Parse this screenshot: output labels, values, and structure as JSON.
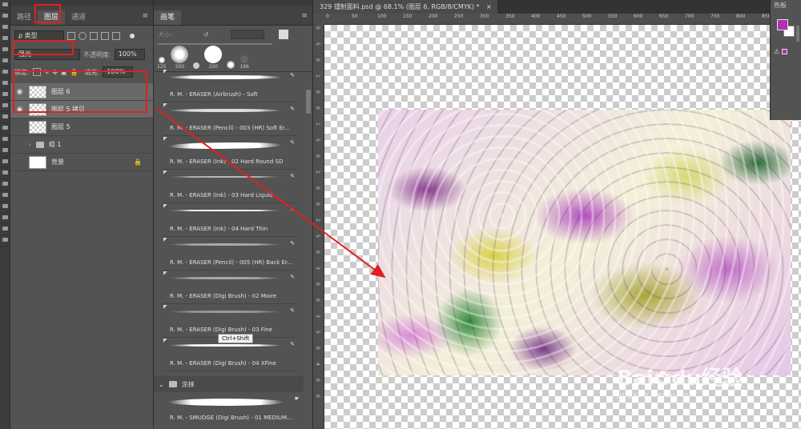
{
  "layers_panel": {
    "tabs": [
      "路径",
      "图层",
      "通道"
    ],
    "filter_label": "ρ 类型",
    "blend_mode": "强光",
    "opacity_label": "不透明度:",
    "opacity_value": "100%",
    "lock_label": "锁定:",
    "fill_label": "填充:",
    "fill_value": "100%",
    "layers": [
      {
        "name": "图层 6",
        "visible": true,
        "selected": true
      },
      {
        "name": "图层 5 拷贝",
        "visible": true,
        "selected": true
      },
      {
        "name": "图层 5",
        "visible": false,
        "selected": false
      },
      {
        "name": "组 1",
        "visible": false,
        "selected": false
      },
      {
        "name": "背景",
        "visible": false,
        "selected": false
      }
    ]
  },
  "brush_panel": {
    "tab": "画笔",
    "size_label": "大小:",
    "tip_sizes": [
      "125",
      "200",
      "200",
      "196"
    ],
    "brushes": [
      "R. M. - ERASER (Airbrush) - Soft",
      "R. M. - ERASER (Pencil) - 003 (HR) Soft Er...",
      "R. M. - ERASER (Ink) - 02 Hard Round SD",
      "R. M. - ERASER (Ink) - 03 Hard Liquid",
      "R. M. - ERASER (Ink) - 04 Hard Thin",
      "R. M. - ERASER (Pencil) - 005 (HR) Back Er...",
      "R. M. - ERASER (Digi Brush) - 02 Moire",
      "R. M. - ERASER (Digi Brush) - 03 Fine",
      "R. M. - ERASER (Digi Brush) - 04 XFine"
    ],
    "group_name": "涂抹",
    "smudge_brush": "R. M. - SMUDGE (Digi Brush) - 01 MEDIUM...",
    "tooltip": "Ctrl+Shift"
  },
  "document": {
    "tab_title": "329 镭射面料.psd @ 68.1% (图层 6, RGB/8/CMYK) *",
    "ruler_h": [
      "0",
      "50",
      "100",
      "150",
      "200",
      "250",
      "300",
      "350",
      "400",
      "450",
      "500",
      "550",
      "600",
      "650",
      "700",
      "750",
      "800",
      "850"
    ],
    "ruler_v": [
      "0",
      "5",
      "0",
      "1",
      "0",
      "0",
      "1",
      "5",
      "0",
      "2",
      "0",
      "0",
      "2",
      "5",
      "0",
      "3",
      "0",
      "0",
      "3",
      "5",
      "0",
      "4",
      "0",
      "0"
    ]
  },
  "color_panel": {
    "title": "色板",
    "foreground": "#b32fb3",
    "background": "#ffffff"
  },
  "watermark": {
    "brand": "Bai",
    "brand2": "du",
    "suffix": "经验",
    "url": "jingyan.baidu.com"
  }
}
